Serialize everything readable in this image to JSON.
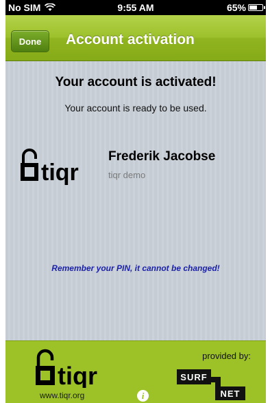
{
  "status_bar": {
    "carrier": "No SIM",
    "time": "9:55 AM",
    "battery": "65%",
    "battery_level": 0.65,
    "wifi_icon": "wifi-icon",
    "battery_icon": "battery-icon"
  },
  "nav": {
    "done_label": "Done",
    "title": "Account activation"
  },
  "content": {
    "headline": "Your account is activated!",
    "subline": "Your account is ready to be used.",
    "user_name": "Frederik Jacobse",
    "user_org": "tiqr demo",
    "logo_text": "tiqr",
    "pin_note": "Remember your PIN, it cannot be changed!"
  },
  "footer": {
    "logo_text": "tiqr",
    "url": "www.tiqr.org",
    "provided_by": "provided by:",
    "surf": "SURF",
    "net": "NET",
    "info_icon": "info-icon"
  },
  "colors": {
    "accent_green": "#9cc228",
    "nav_dark_green": "#4f7f10",
    "pin_blue": "#1c22a8"
  }
}
